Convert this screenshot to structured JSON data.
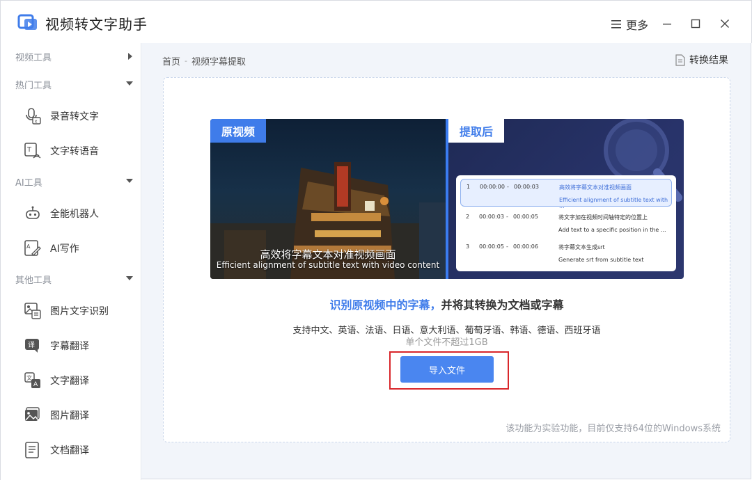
{
  "app": {
    "title": "视频转文字助手",
    "more_label": "更多"
  },
  "sidebar": {
    "groups": [
      {
        "label": "视频工具",
        "state": "collapsed"
      },
      {
        "label": "热门工具",
        "state": "expanded"
      },
      {
        "label": "AI工具",
        "state": "expanded"
      },
      {
        "label": "其他工具",
        "state": "expanded"
      }
    ],
    "items": [
      {
        "label": "录音转文字",
        "icon": "microphone-text-icon"
      },
      {
        "label": "文字转语音",
        "icon": "text-to-speech-icon"
      },
      {
        "label": "全能机器人",
        "icon": "robot-icon"
      },
      {
        "label": "AI写作",
        "icon": "ai-writing-icon"
      },
      {
        "label": "图片文字识别",
        "icon": "image-ocr-icon"
      },
      {
        "label": "字幕翻译",
        "icon": "subtitle-translate-icon"
      },
      {
        "label": "文字翻译",
        "icon": "text-translate-icon"
      },
      {
        "label": "图片翻译",
        "icon": "image-translate-icon"
      },
      {
        "label": "文档翻译",
        "icon": "document-translate-icon"
      }
    ]
  },
  "breadcrumb": {
    "home": "首页",
    "current": "视频字幕提取"
  },
  "result_link": "转换结果",
  "preview": {
    "tag_before": "原视频",
    "tag_after": "提取后",
    "subtitle_cn": "高效将字幕文本对准视频画面",
    "subtitle_en": "Efficient alignment of subtitle text with video content",
    "rows": [
      {
        "index": "1",
        "start": "00:00:00",
        "dash": "-",
        "end": "00:00:03",
        "cn": "高效将字幕文本对准视频画面",
        "en": "Efficient alignment of subtitle text with ..."
      },
      {
        "index": "2",
        "start": "00:00:03",
        "dash": "-",
        "end": "00:00:05",
        "cn": "将文字加在视频时间轴特定的位置上",
        "en": "Add text to a specific position in the ..."
      },
      {
        "index": "3",
        "start": "00:00:05",
        "dash": "-",
        "end": "00:00:06",
        "cn": "将字幕文本生成srt",
        "en": "Generate srt from subtitle text"
      }
    ]
  },
  "headline": {
    "highlight": "识别原视频中的字幕，",
    "rest": "并将其转换为文档或字幕"
  },
  "languages": "支持中文、英语、法语、日语、意大利语、葡萄牙语、韩语、德语、西班牙语",
  "limit": "单个文件不超过1GB",
  "import_label": "导入文件",
  "note": "该功能为实验功能，目前仅支持64位的Windows系统",
  "colors": {
    "accent": "#3f7cea",
    "button": "#4a86f0",
    "highlight_box": "#d9262a",
    "main_bg": "#f2f5fa"
  }
}
